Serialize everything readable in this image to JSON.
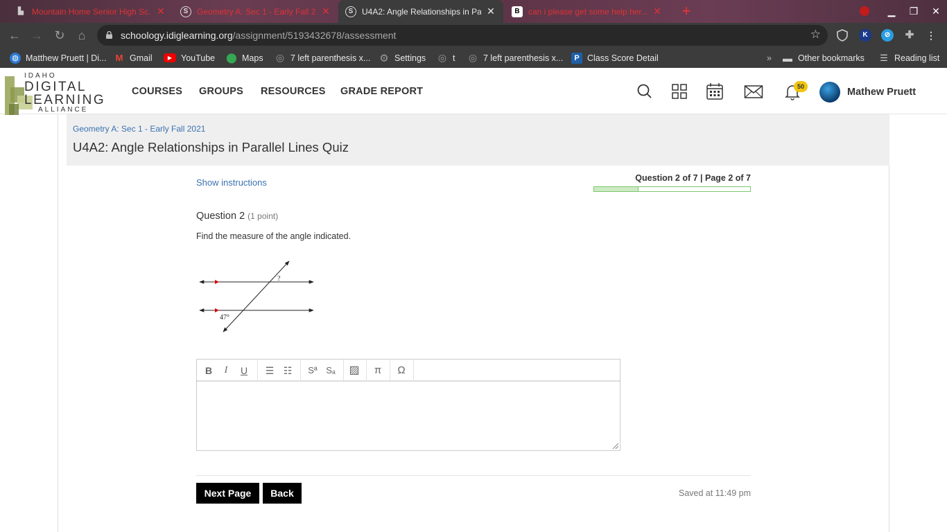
{
  "browser": {
    "tabs": [
      {
        "title": "Mountain Home Senior High Sc...",
        "active": false
      },
      {
        "title": "Geometry A: Sec 1 - Early Fall 2",
        "active": false
      },
      {
        "title": "U4A2: Angle Relationships in Pa",
        "active": true
      },
      {
        "title": "can i please get some help her...",
        "active": false
      }
    ],
    "new_tab_label": "+",
    "url_host": "schoology.idiglearning.org",
    "url_path": "/assignment/5193432678/assessment",
    "bookmarks": [
      {
        "label": "Matthew Pruett | Di...",
        "icon": "globe-icon"
      },
      {
        "label": "Gmail",
        "icon": "gmail-icon"
      },
      {
        "label": "YouTube",
        "icon": "youtube-icon"
      },
      {
        "label": "Maps",
        "icon": "maps-icon"
      },
      {
        "label": "7 left parenthesis x...",
        "icon": "globe-icon"
      },
      {
        "label": "Settings",
        "icon": "gear-icon"
      },
      {
        "label": "t",
        "icon": "globe-icon"
      },
      {
        "label": "7 left parenthesis x...",
        "icon": "globe-icon"
      },
      {
        "label": "Class Score Detail",
        "icon": "powerschool-icon"
      }
    ],
    "bookmarks_overflow": "»",
    "other_bookmarks": "Other bookmarks",
    "reading_list": "Reading list"
  },
  "site": {
    "logo": {
      "line1": "IDAHO",
      "line2": "DIGITAL",
      "line3": "LEARNING",
      "line4": "ALLIANCE"
    },
    "nav": [
      "COURSES",
      "GROUPS",
      "RESOURCES",
      "GRADE REPORT"
    ],
    "notification_count": "50",
    "user_name": "Mathew Pruett"
  },
  "page": {
    "breadcrumb": "Geometry A: Sec 1 - Early Fall 2021",
    "title": "U4A2: Angle Relationships in Parallel Lines Quiz",
    "show_instructions": "Show instructions",
    "progress_text": "Question 2 of 7 | Page 2 of 7",
    "progress_fraction": 0.2857,
    "question_label": "Question 2",
    "question_points": "(1 point)",
    "question_text": "Find the measure of the angle indicated.",
    "figure": {
      "unknown_label": "?",
      "angle_label": "47°"
    },
    "editor_tools": [
      {
        "name": "bold",
        "glyph": "B"
      },
      {
        "name": "italic",
        "glyph": "I"
      },
      {
        "name": "underline",
        "glyph": "U"
      },
      {
        "name": "bullet-list",
        "glyph": "☰"
      },
      {
        "name": "numbered-list",
        "glyph": "☷"
      },
      {
        "name": "superscript",
        "glyph": "Sª"
      },
      {
        "name": "subscript",
        "glyph": "Sₐ"
      },
      {
        "name": "image",
        "glyph": "▨"
      },
      {
        "name": "pi",
        "glyph": "π"
      },
      {
        "name": "omega",
        "glyph": "Ω"
      }
    ],
    "next_button": "Next Page",
    "back_button": "Back",
    "saved_status": "Saved at 11:49 pm"
  }
}
